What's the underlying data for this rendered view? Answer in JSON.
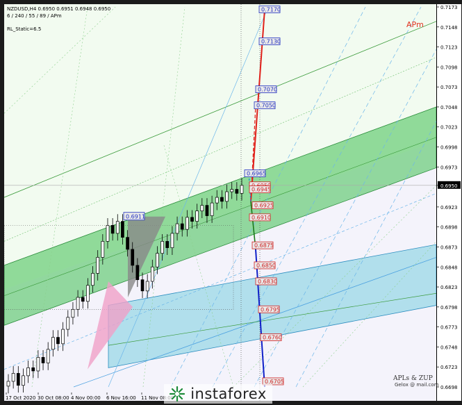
{
  "header": {
    "symbol_line": "NZDUSD,H4  0.6950 0.6951 0.6948 0.6950",
    "settings_line": "6 / 240 / 55 / 89 / APm",
    "static_line": "RL_Static=6.5"
  },
  "labels": {
    "apm": "APm",
    "brand": "APLs & ZUP",
    "brand_sub": "Gelox @ mail.com",
    "watermark": "instaforex"
  },
  "colors": {
    "green_band": "#3fbf52",
    "blue_band": "#5fc7d9",
    "up_projection": "#e0201a",
    "down_projection": "#1020c8",
    "grey_triangle": "#888888",
    "pink_triangle": "#f0a0c8",
    "price_tag_bg": "#e9e9e9",
    "level_blue_border": "#2030c0",
    "level_red_border": "#d02020"
  },
  "chart_data": {
    "type": "candlestick",
    "title": "NZDUSD,H4",
    "ylim": [
      0.6698,
      0.7173
    ],
    "y_ticks": [
      "0.7173",
      "0.7148",
      "0.7123",
      "0.7098",
      "0.7073",
      "0.7048",
      "0.7023",
      "0.6998",
      "0.6973",
      "0.6950",
      "0.6923",
      "0.6898",
      "0.6873",
      "0.6848",
      "0.6823",
      "0.6798",
      "0.6773",
      "0.6748",
      "0.6723",
      "0.6698"
    ],
    "current_price": "0.6950",
    "x_ticks": [
      "17 Oct 2020",
      "30 Oct 08:00",
      "4 Nov 00:00",
      "6 Nov 16:00",
      "11 Nov 08:00"
    ],
    "high_marker": "0.6911",
    "projection_levels_blue": [
      "0.7170",
      "0.7130",
      "0.7070",
      "0.7050",
      "0.6965"
    ],
    "projection_levels_red": [
      "0.6950",
      "0.6945",
      "0.6925",
      "0.6910",
      "0.6875",
      "0.6850",
      "0.6830",
      "0.6795",
      "0.6760",
      "0.6705"
    ],
    "close_series": [
      0.6705,
      0.6715,
      0.67,
      0.6712,
      0.6722,
      0.6718,
      0.6735,
      0.6728,
      0.6745,
      0.676,
      0.6752,
      0.677,
      0.6785,
      0.6795,
      0.681,
      0.6805,
      0.6825,
      0.684,
      0.686,
      0.688,
      0.69,
      0.689,
      0.6905,
      0.6885,
      0.687,
      0.685,
      0.6832,
      0.6818,
      0.683,
      0.6848,
      0.6865,
      0.688,
      0.6872,
      0.689,
      0.6902,
      0.6895,
      0.691,
      0.6905,
      0.6918,
      0.6925,
      0.6912,
      0.6928,
      0.6935,
      0.693,
      0.6942,
      0.6945,
      0.694,
      0.695
    ]
  }
}
